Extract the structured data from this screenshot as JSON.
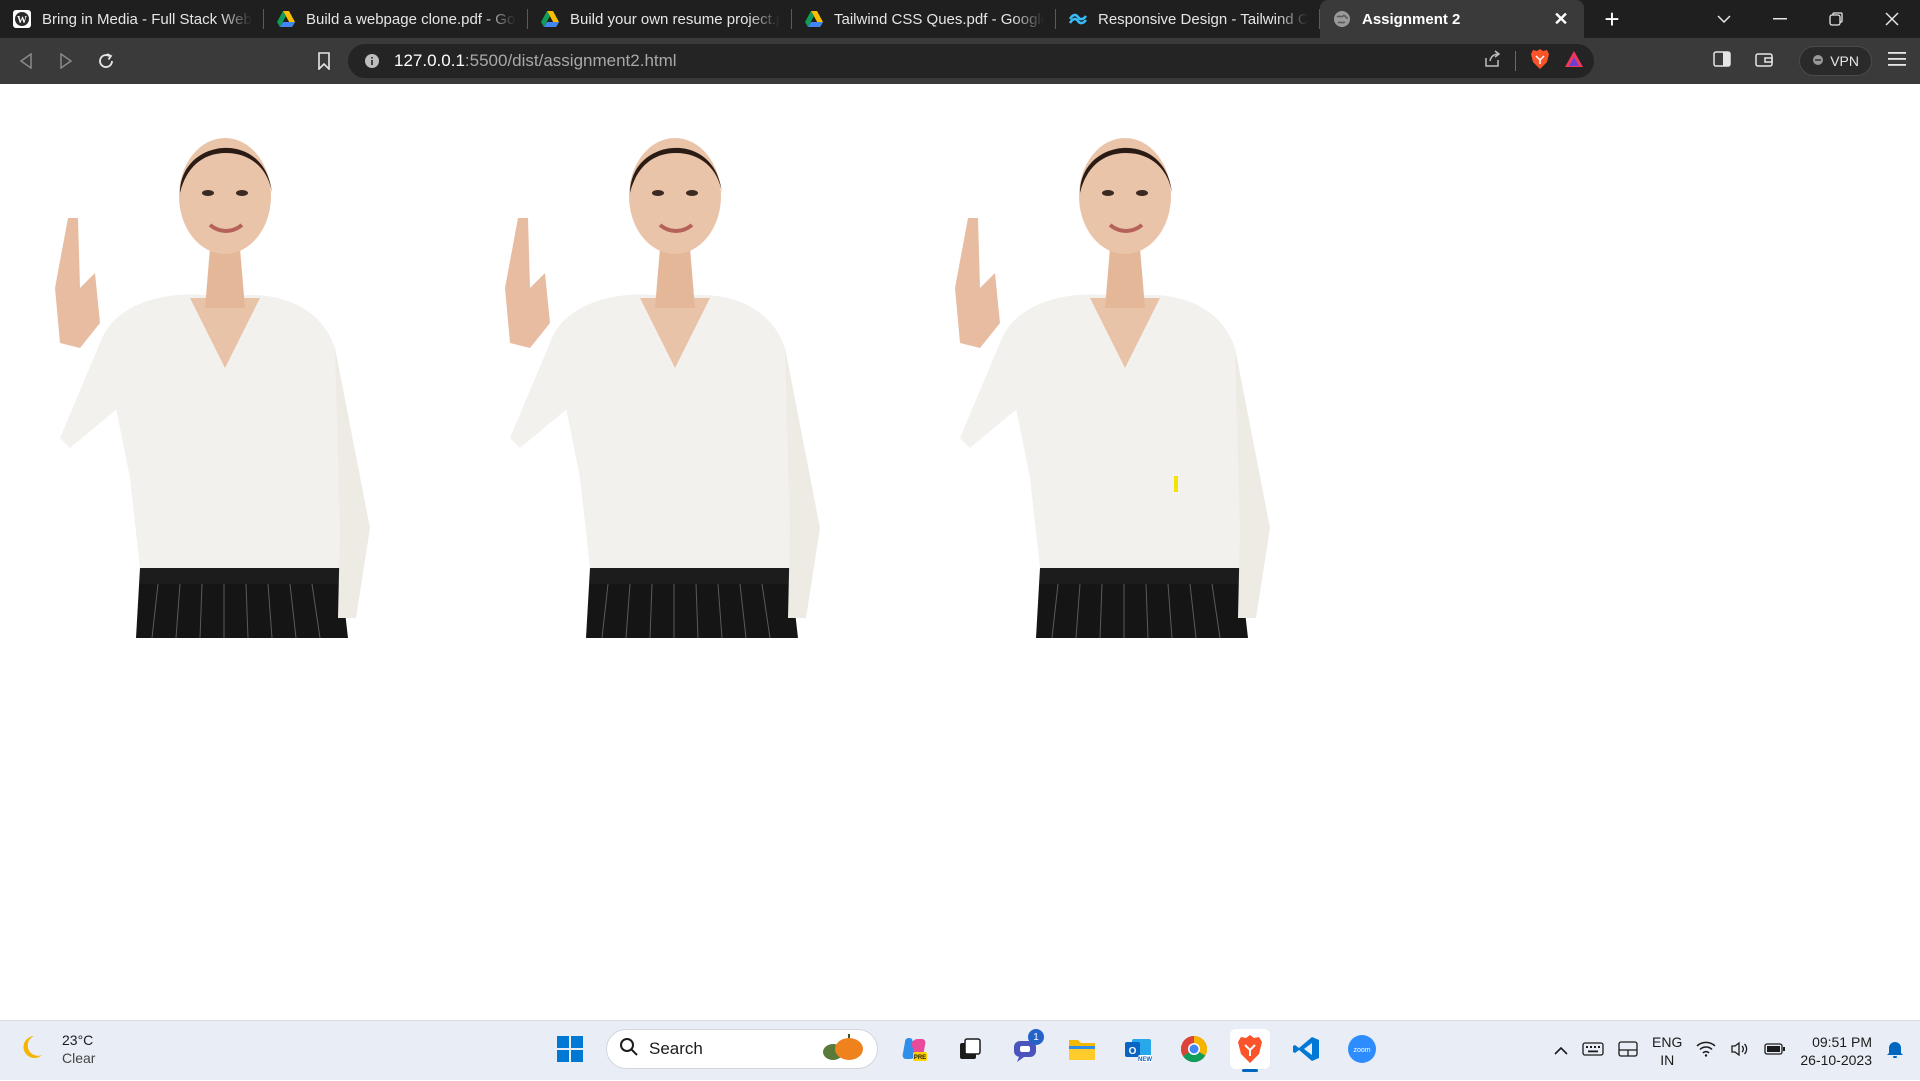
{
  "browser": {
    "tabs": [
      {
        "title": "Bring in Media - Full Stack Web D",
        "icon": "wordpress-icon",
        "active": false
      },
      {
        "title": "Build a webpage clone.pdf - Goo",
        "icon": "google-drive-icon",
        "active": false
      },
      {
        "title": "Build your own resume project.p",
        "icon": "google-drive-icon",
        "active": false
      },
      {
        "title": "Tailwind CSS Ques.pdf - Google I",
        "icon": "google-drive-icon",
        "active": false
      },
      {
        "title": "Responsive Design - Tailwind CSS",
        "icon": "tailwind-icon",
        "active": false
      },
      {
        "title": "Assignment 2",
        "icon": "globe-icon",
        "active": true
      }
    ],
    "address": {
      "host": "127.0.0.1",
      "path": ":5500/dist/assignment2.html"
    },
    "vpn_label": "VPN"
  },
  "page": {
    "images": [
      {
        "description": "woman-pointing-up"
      },
      {
        "description": "woman-pointing-up"
      },
      {
        "description": "woman-pointing-up"
      }
    ]
  },
  "taskbar": {
    "weather": {
      "temp": "23°C",
      "condition": "Clear"
    },
    "search_placeholder": "Search",
    "teams_badge": "1",
    "language": {
      "line1": "ENG",
      "line2": "IN"
    },
    "clock": {
      "time": "09:51 PM",
      "date": "26-10-2023"
    }
  }
}
